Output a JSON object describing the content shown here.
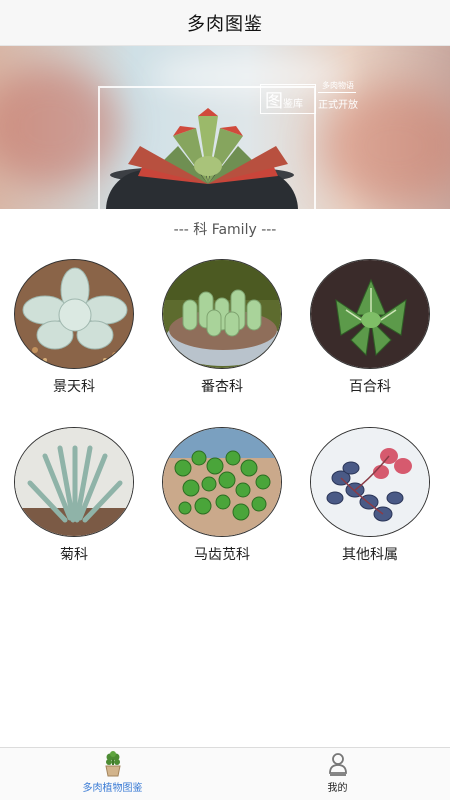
{
  "header": {
    "title": "多肉图鉴"
  },
  "banner": {
    "brand_big": "图",
    "brand_small": "鉴库",
    "brand_tiny": "多肉物语",
    "brand_tagline": "正式开放",
    "slides": 3,
    "active_slide": 0
  },
  "section": {
    "title": "--- 科 Family ---"
  },
  "families": [
    {
      "label": "景天科",
      "icon": "echeveria-photo"
    },
    {
      "label": "番杏科",
      "icon": "lithops-photo"
    },
    {
      "label": "百合科",
      "icon": "haworthia-photo"
    },
    {
      "label": "菊科",
      "icon": "senecio-photo"
    },
    {
      "label": "马齿苋科",
      "icon": "portulacaria-photo"
    },
    {
      "label": "其他科属",
      "icon": "peperomia-photo"
    }
  ],
  "tabbar": {
    "tabs": [
      {
        "label": "多肉植物图鉴",
        "icon": "potted-plant-icon",
        "active": true
      },
      {
        "label": "我的",
        "icon": "user-icon",
        "active": false
      }
    ],
    "accent": "#3a7bd5"
  }
}
